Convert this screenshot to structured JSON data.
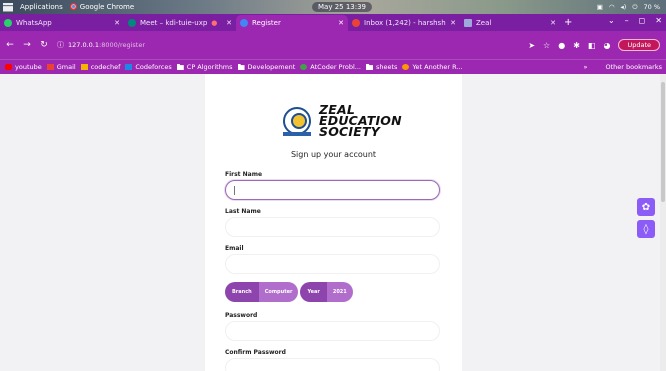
{
  "os_bar": {
    "applications": "Applications",
    "active_app": "Google Chrome",
    "clock": "May 25 13:39",
    "battery": "70 %"
  },
  "tabs": [
    {
      "title": "WhatsApp",
      "favicon_color": "#25d366",
      "active": false
    },
    {
      "title": "Meet – kdi-tuie-uxp",
      "favicon_color": "#00897b",
      "active": false
    },
    {
      "title": "Register",
      "favicon_color": "#4285f4",
      "active": true
    },
    {
      "title": "Inbox (1,242) - harshsh",
      "favicon_color": "#ea4335",
      "active": false
    },
    {
      "title": "Zeal",
      "favicon_color": "#9fa8da",
      "active": false
    }
  ],
  "address_bar": {
    "host": "127.0.0.1",
    "path": ":8000/register",
    "update_label": "Update"
  },
  "bookmarks": [
    {
      "label": "youtube",
      "icon": "youtube-icon",
      "color": "#ff0000"
    },
    {
      "label": "Gmail",
      "icon": "gmail-icon",
      "color": "#ea4335"
    },
    {
      "label": "codechef",
      "icon": "codechef-icon",
      "color": "#f4b400"
    },
    {
      "label": "Codeforces",
      "icon": "codeforces-icon",
      "color": "#1e88e5"
    },
    {
      "label": "CP Algorithms",
      "icon": "folder-icon",
      "color": "#ffffff"
    },
    {
      "label": "Developement",
      "icon": "folder-icon",
      "color": "#ffffff"
    },
    {
      "label": "AtCoder Probl...",
      "icon": "atcoder-icon",
      "color": "#43a047"
    },
    {
      "label": "sheets",
      "icon": "folder-icon",
      "color": "#ffffff"
    },
    {
      "label": "Yet Another R...",
      "icon": "yar-icon",
      "color": "#ff9800"
    }
  ],
  "other_bookmarks": "Other bookmarks",
  "form": {
    "org_line1": "ZEAL",
    "org_line2": "EDUCATION",
    "org_line3": "SOCIETY",
    "heading": "Sign up your account",
    "first_name_label": "First Name",
    "last_name_label": "Last Name",
    "email_label": "Email",
    "branch_key": "Branch",
    "branch_value": "Computer",
    "year_key": "Year",
    "year_value": "2021",
    "password_label": "Password",
    "confirm_password_label": "Confirm Password"
  },
  "colors": {
    "theme_purple": "#9c27b0",
    "tab_strip": "#7b1fa2",
    "pill_dark": "#8e44ad",
    "pill_light": "#b16dcc",
    "floating_button": "#8b5cf6"
  }
}
